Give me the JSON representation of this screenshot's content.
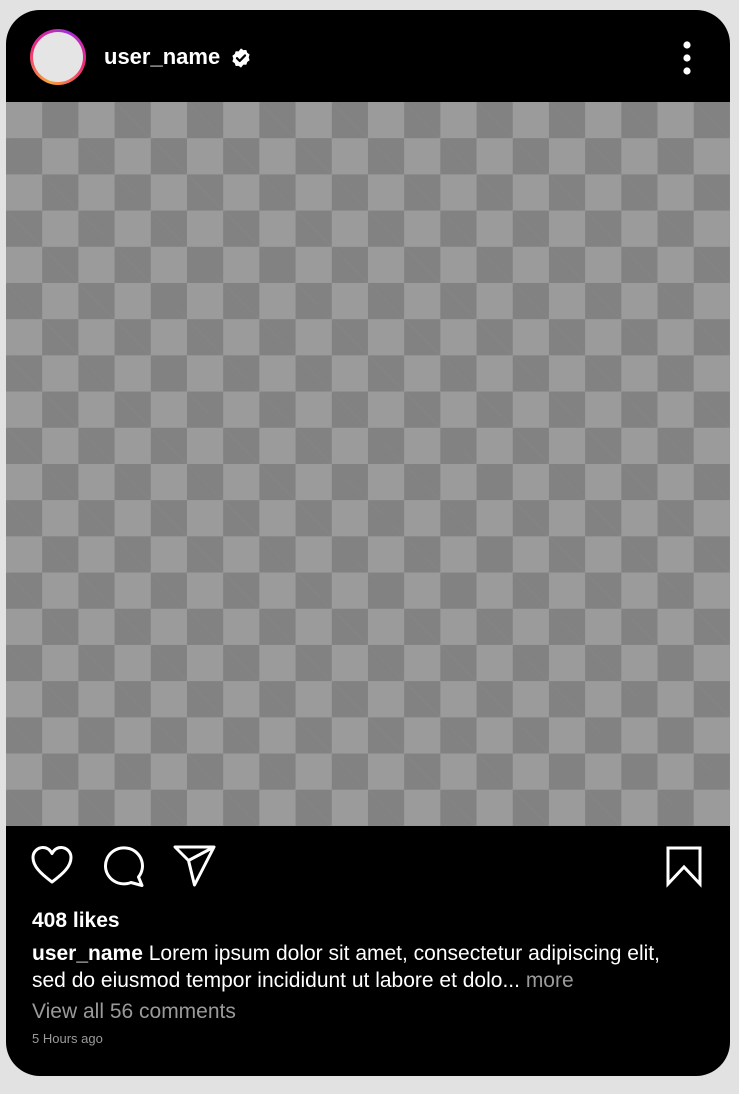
{
  "post": {
    "username": "user_name",
    "likes": "408 likes",
    "caption_user": "user_name",
    "caption_text": "Lorem ipsum dolor sit amet, consectetur adipiscing elit, sed do eiusmod tempor incididunt ut labore et dolo...",
    "caption_more": "more",
    "view_comments": "View all 56 comments",
    "timestamp": "5 Hours ago"
  },
  "icons": {
    "verified": "verified-badge-icon",
    "more": "more-vertical-icon",
    "like": "heart-icon",
    "comment": "comment-bubble-icon",
    "share": "paper-plane-icon",
    "save": "bookmark-icon"
  },
  "colors": {
    "card_background": "#000000",
    "page_background": "#e2e2e2",
    "text_primary": "#ffffff",
    "text_secondary": "#9a9a9a",
    "avatar_ring_start": "#f9a33a",
    "avatar_ring_mid": "#ee2a7b",
    "avatar_ring_end": "#a52fd8"
  }
}
